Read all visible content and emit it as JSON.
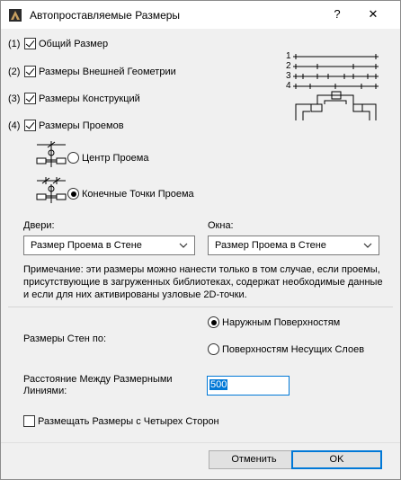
{
  "window": {
    "title": "Автопроставляемые Размеры",
    "help_label": "?",
    "close_label": "✕"
  },
  "dimensions": [
    {
      "num": "(1)",
      "label": "Общий Размер",
      "checked": true
    },
    {
      "num": "(2)",
      "label": "Размеры Внешней Геометрии",
      "checked": true
    },
    {
      "num": "(3)",
      "label": "Размеры Конструкций",
      "checked": true
    },
    {
      "num": "(4)",
      "label": "Размеры Проемов",
      "checked": true
    }
  ],
  "legend_numbers": [
    "1",
    "2",
    "3",
    "4"
  ],
  "opening_options": [
    {
      "label": "Центр Проема",
      "selected": false
    },
    {
      "label": "Конечные Точки Проема",
      "selected": true
    }
  ],
  "doors": {
    "label": "Двери:",
    "value": "Размер Проема в Стене"
  },
  "windows": {
    "label": "Окна:",
    "value": "Размер Проема в Стене"
  },
  "note": "Примечание: эти размеры можно нанести только в том случае, если проемы, присутствующие в загруженных библиотеках, содержат необходимые данные и если для них активированы узловые 2D-точки.",
  "walls": {
    "label": "Размеры Стен по:",
    "options": [
      {
        "label": "Наружным Поверхностям",
        "selected": true
      },
      {
        "label": "Поверхностям Несущих Слоев",
        "selected": false
      }
    ]
  },
  "distance": {
    "label_line1": "Расстояние Между Размерными",
    "label_line2": "Линиями:",
    "value": "500"
  },
  "four_sides": {
    "label": "Размещать Размеры с Четырех Сторон",
    "checked": false
  },
  "buttons": {
    "cancel": "Отменить",
    "ok": "OK"
  }
}
